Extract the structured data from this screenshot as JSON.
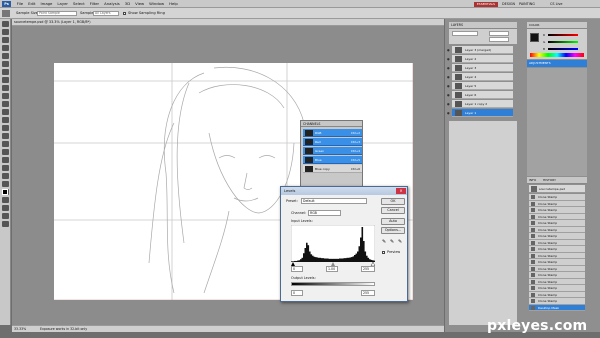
{
  "app": {
    "logo": "Ps"
  },
  "menu": [
    "File",
    "Edit",
    "Image",
    "Layer",
    "Select",
    "Filter",
    "Analysis",
    "3D",
    "View",
    "Window",
    "Help"
  ],
  "workspace": {
    "label": "ESSENTIALS",
    "design": "DESIGN",
    "painting": "PAINTING",
    "cs_live": "CS Live"
  },
  "options": {
    "sample_size_label": "Sample Size:",
    "sample_size_value": "Point Sample",
    "sample_label": "Sample:",
    "sample_value": "All Layers",
    "show_ring": "Show Sampling Ring"
  },
  "document": {
    "tab": "sourcetempe.psd @ 33.3% (Layer 1, RGB/8*)",
    "zoom": "33.33%",
    "status": "Exposure works in 32-bit only"
  },
  "layers_panel": {
    "tabs": [
      "LAYERS"
    ],
    "items": [
      {
        "name": "Layer 3 (merged)"
      },
      {
        "name": "Layer 2"
      },
      {
        "name": "Layer 3"
      },
      {
        "name": "Layer 4"
      },
      {
        "name": "Layer 5"
      },
      {
        "name": "Layer 6"
      },
      {
        "name": "Layer 1 copy 2"
      },
      {
        "name": "Layer 1"
      }
    ]
  },
  "color_panel": {
    "tabs": [
      "COLOR",
      "SWATCHES",
      "STYLES"
    ],
    "r": "R",
    "g": "G",
    "b": "B"
  },
  "adjust_panel": {
    "tabs": [
      "ADJUSTMENTS",
      "MASKS"
    ]
  },
  "channels_panel": {
    "title": "CHANNELS",
    "items": [
      {
        "name": "RGB",
        "shortcut": "Ctrl+2"
      },
      {
        "name": "Red",
        "shortcut": "Ctrl+3"
      },
      {
        "name": "Green",
        "shortcut": "Ctrl+4"
      },
      {
        "name": "Blue",
        "shortcut": "Ctrl+5"
      },
      {
        "name": "Blue copy",
        "shortcut": "Ctrl+6"
      }
    ]
  },
  "history_panel": {
    "tabs": [
      "INFO",
      "HISTORY"
    ],
    "snapshot": "sourcetempe.psd",
    "items": [
      "Clone Stamp",
      "Clone Stamp",
      "Clone Stamp",
      "Clone Stamp",
      "Clone Stamp",
      "Clone Stamp",
      "Clone Stamp",
      "Clone Stamp",
      "Clone Stamp",
      "Clone Stamp",
      "Clone Stamp",
      "Clone Stamp",
      "Clone Stamp",
      "Clone Stamp",
      "Clone Stamp",
      "Clone Stamp",
      "Clone Stamp"
    ],
    "current": "Desktop Mask"
  },
  "levels": {
    "title": "Levels",
    "preset_label": "Preset:",
    "preset_value": "Default",
    "channel_label": "Channel:",
    "channel_value": "RGB",
    "input_label": "Input Levels:",
    "input_black": "0",
    "input_gamma": "1.00",
    "input_white": "255",
    "output_label": "Output Levels:",
    "output_black": "0",
    "output_white": "255",
    "buttons": {
      "ok": "OK",
      "cancel": "Cancel",
      "auto": "Auto",
      "options": "Options..."
    },
    "preview_label": "Preview",
    "histogram": [
      2,
      2,
      3,
      3,
      4,
      5,
      8,
      12,
      25,
      40,
      55,
      48,
      30,
      22,
      18,
      15,
      14,
      13,
      12,
      12,
      11,
      11,
      10,
      10,
      10,
      9,
      9,
      9,
      9,
      9,
      9,
      9,
      10,
      10,
      10,
      11,
      11,
      12,
      12,
      13,
      14,
      16,
      20,
      24,
      30,
      45,
      70,
      100,
      60,
      30,
      18,
      12,
      8,
      6,
      5,
      4
    ]
  },
  "watermark": "pxleyes.com"
}
